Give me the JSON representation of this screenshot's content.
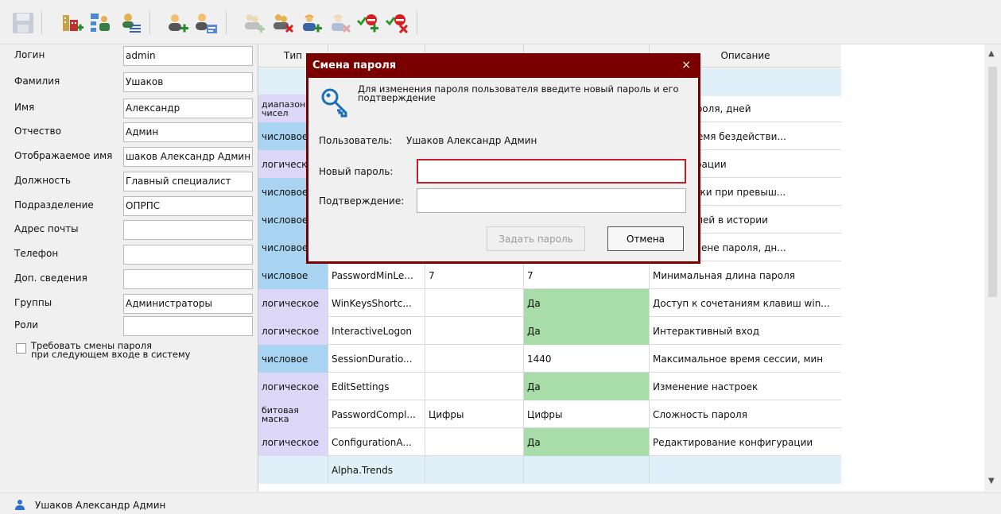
{
  "toolbar": {
    "icons": [
      "save-icon",
      "add-org-unit-icon",
      "org-structure-icon",
      "users-list-icon",
      "add-user-icon",
      "user-card-icon",
      "add-user-disabled-icon",
      "delete-user-icon",
      "add-worker-icon",
      "delete-worker-disabled-icon",
      "add-permission-icon",
      "delete-permission-icon"
    ]
  },
  "form": {
    "login": {
      "label": "Логин",
      "value": "admin"
    },
    "lastname": {
      "label": "Фамилия",
      "value": "Ушаков"
    },
    "firstname": {
      "label": "Имя",
      "value": "Александр"
    },
    "middlename": {
      "label": "Отчество",
      "value": "Админ"
    },
    "displayname": {
      "label": "Отображаемое имя",
      "value": "шаков Александр Админ"
    },
    "position": {
      "label": "Должность",
      "value": "Главный специалист"
    },
    "department": {
      "label": "Подразделение",
      "value": "ОПРПС"
    },
    "email": {
      "label": "Адрес почты",
      "value": ""
    },
    "phone": {
      "label": "Телефон",
      "value": ""
    },
    "extra": {
      "label": "Доп. сведения",
      "value": ""
    },
    "groups": {
      "label": "Группы",
      "value": "Администраторы"
    },
    "roles": {
      "label": "Роли",
      "value": ""
    },
    "must_change": {
      "label": "Требовать смены пароля\nпри следующем входе в систему",
      "checked": false
    }
  },
  "grid": {
    "headers": [
      "Тип",
      "",
      "",
      "",
      "Описание"
    ],
    "rows": [
      {
        "type": "",
        "name": "",
        "val1": "",
        "val2": "",
        "desc": ""
      },
      {
        "type": "диапазон чисел",
        "name": "",
        "val1": "",
        "val2": "",
        "desc": "ствия пароля, дней"
      },
      {
        "type": "числовое",
        "name": "",
        "val1": "",
        "val2": "",
        "desc": "льное время бездействи..."
      },
      {
        "type": "логическое",
        "name": "",
        "val1": "",
        "val2": "",
        "desc": "конфигурации"
      },
      {
        "type": "числовое",
        "name": "",
        "val1": "",
        "val2": "",
        "desc": "блокировки при превыш..."
      },
      {
        "type": "числовое",
        "name": "",
        "val1": "",
        "val2": "",
        "desc": "тво паролей в истории"
      },
      {
        "type": "числовое",
        "name": "",
        "val1": "",
        "val2": "",
        "desc": "ение о смене пароля, дн..."
      },
      {
        "type": "числовое",
        "name": "PasswordMinLe...",
        "val1": "7",
        "val2": "7",
        "desc": "Минимальная длина пароля"
      },
      {
        "type": "логическое",
        "name": "WinKeysShortc...",
        "val1": "",
        "val2": "Да",
        "desc": "Доступ к сочетаниям клавиш win..."
      },
      {
        "type": "логическое",
        "name": "InteractiveLogon",
        "val1": "",
        "val2": "Да",
        "desc": "Интерактивный вход"
      },
      {
        "type": "числовое",
        "name": "SessionDuratio...",
        "val1": "",
        "val2": "1440",
        "desc": "Максимальное время сессии, мин"
      },
      {
        "type": "логическое",
        "name": "EditSettings",
        "val1": "",
        "val2": "Да",
        "desc": "Изменение настроек"
      },
      {
        "type": "битовая маска",
        "name": "PasswordCompl...",
        "val1": "Цифры",
        "val2": "Цифры",
        "desc": "Сложность пароля"
      },
      {
        "type": "логическое",
        "name": "ConfigurationA...",
        "val1": "",
        "val2": "Да",
        "desc": "Редактирование конфигурации"
      },
      {
        "type": "",
        "name": "Alpha.Trends",
        "val1": "",
        "val2": "",
        "desc": ""
      }
    ]
  },
  "dialog": {
    "title": "Смена пароля",
    "close": "×",
    "info": "Для изменения пароля пользователя введите новый пароль и его подтверждение",
    "user_label": "Пользователь:",
    "user_value": "Ушаков Александр Админ",
    "new_label": "Новый пароль:",
    "new_value": "",
    "confirm_label": "Подтверждение:",
    "confirm_value": "",
    "set_button": "Задать пароль",
    "cancel_button": "Отмена"
  },
  "status": {
    "user": "Ушаков Александр Админ"
  },
  "colors": {
    "numeric": "#a8d4f2",
    "logical": "#ddd7f7",
    "group": "#dff0f8",
    "yes": "#a8dca8",
    "dialog_frame": "#7a0000",
    "focus": "#c0202a"
  }
}
